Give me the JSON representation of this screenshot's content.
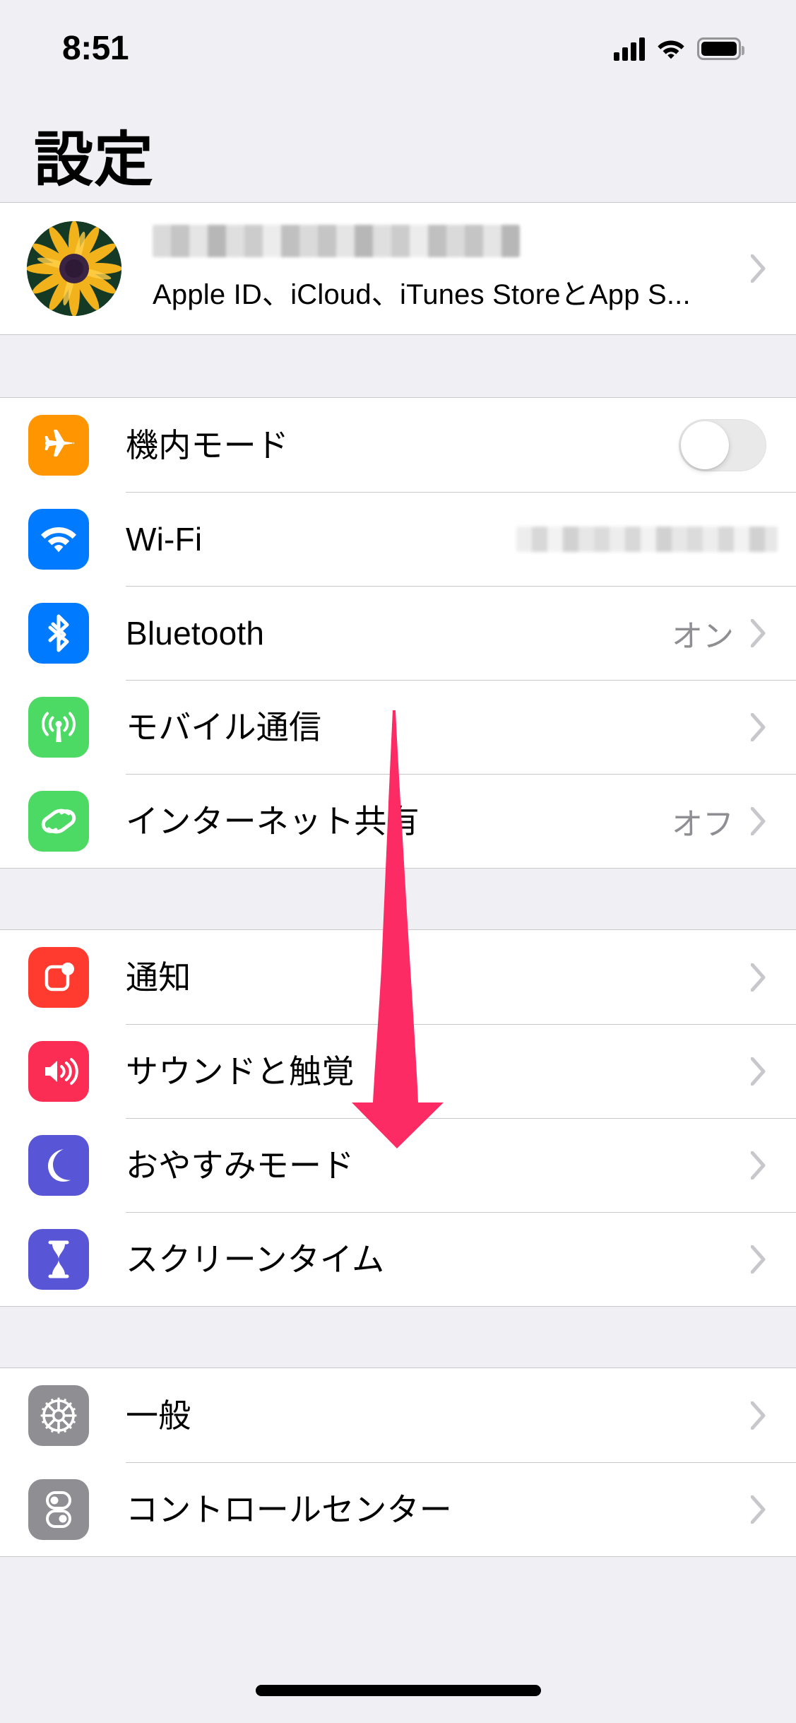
{
  "status_bar": {
    "time": "8:51",
    "signal_icon": "cellular-bars-icon",
    "wifi_icon": "wifi-icon",
    "battery_icon": "battery-full-icon",
    "battery_level_percent": 100
  },
  "header": {
    "title": "設定"
  },
  "account": {
    "name_redacted": true,
    "name": "",
    "subtitle": "Apple ID、iCloud、iTunes StoreとApp S...",
    "avatar_icon": "sunflower-avatar",
    "avatar_colors": {
      "background": "#123524",
      "petal": "#F2B01E",
      "petal_light": "#FFD24D",
      "center": "#3B2545"
    },
    "chevron": "chevron-right-icon"
  },
  "groups": [
    {
      "id": "connectivity",
      "rows": [
        {
          "id": "airplane-mode",
          "label": "機内モード",
          "icon": "airplane-icon",
          "icon_color": "#FF9500",
          "control": "toggle",
          "toggle_on": false,
          "value": ""
        },
        {
          "id": "wifi",
          "label": "Wi-Fi",
          "icon": "wifi-icon",
          "icon_color": "#007AFF",
          "control": "redacted-value",
          "value": "",
          "value_redacted": true
        },
        {
          "id": "bluetooth",
          "label": "Bluetooth",
          "icon": "bluetooth-icon",
          "icon_color": "#007AFF",
          "control": "value-chevron",
          "value": "オン"
        },
        {
          "id": "cellular",
          "label": "モバイル通信",
          "icon": "cellular-antenna-icon",
          "icon_color": "#4CD964",
          "control": "chevron",
          "value": ""
        },
        {
          "id": "personal-hotspot",
          "label": "インターネット共有",
          "icon": "hotspot-link-icon",
          "icon_color": "#4CD964",
          "control": "value-chevron",
          "value": "オフ"
        }
      ]
    },
    {
      "id": "notifications",
      "rows": [
        {
          "id": "notifications",
          "label": "通知",
          "icon": "notification-badge-icon",
          "icon_color": "#FF3B30",
          "control": "chevron",
          "value": ""
        },
        {
          "id": "sounds-haptics",
          "label": "サウンドと触覚",
          "icon": "speaker-waves-icon",
          "icon_color": "#FC2D55",
          "control": "chevron",
          "value": ""
        },
        {
          "id": "do-not-disturb",
          "label": "おやすみモード",
          "icon": "crescent-moon-icon",
          "icon_color": "#5856D6",
          "control": "chevron",
          "value": ""
        },
        {
          "id": "screen-time",
          "label": "スクリーンタイム",
          "icon": "hourglass-icon",
          "icon_color": "#5856D6",
          "control": "chevron",
          "value": ""
        }
      ]
    },
    {
      "id": "system",
      "rows": [
        {
          "id": "general",
          "label": "一般",
          "icon": "gear-icon",
          "icon_color": "#8E8E93",
          "control": "chevron",
          "value": ""
        },
        {
          "id": "control-center",
          "label": "コントロールセンター",
          "icon": "control-center-icon",
          "icon_color": "#8E8E93",
          "control": "chevron",
          "value": ""
        }
      ]
    }
  ],
  "annotation": {
    "type": "down-arrow",
    "color": "#FC2B63",
    "meaning": "scroll-down-indicator"
  },
  "home_indicator": {
    "visible": true,
    "color": "#000000"
  }
}
